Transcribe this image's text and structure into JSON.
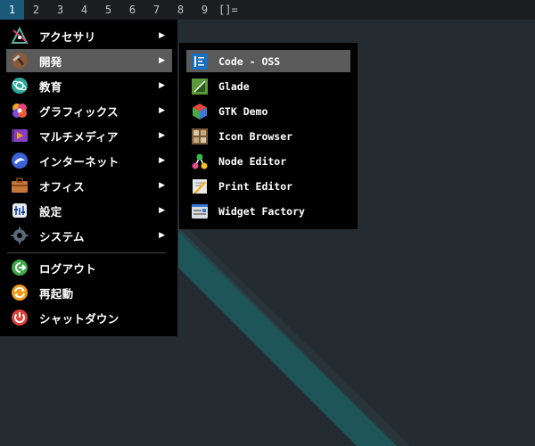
{
  "topbar": {
    "workspaces": [
      "1",
      "2",
      "3",
      "4",
      "5",
      "6",
      "7",
      "8",
      "9"
    ],
    "active_workspace": "1",
    "layout_symbol": "[]="
  },
  "menu": {
    "categories": [
      {
        "label": "アクセサリ",
        "icon": "accessories-icon",
        "has_submenu": true
      },
      {
        "label": "開発",
        "icon": "development-icon",
        "has_submenu": true
      },
      {
        "label": "教育",
        "icon": "education-icon",
        "has_submenu": true
      },
      {
        "label": "グラフィックス",
        "icon": "graphics-icon",
        "has_submenu": true
      },
      {
        "label": "マルチメディア",
        "icon": "multimedia-icon",
        "has_submenu": true
      },
      {
        "label": "インターネット",
        "icon": "internet-icon",
        "has_submenu": true
      },
      {
        "label": "オフィス",
        "icon": "office-icon",
        "has_submenu": true
      },
      {
        "label": "設定",
        "icon": "settings-icon",
        "has_submenu": true
      },
      {
        "label": "システム",
        "icon": "system-icon",
        "has_submenu": true
      }
    ],
    "session": [
      {
        "label": "ログアウト",
        "icon": "logout-icon"
      },
      {
        "label": "再起動",
        "icon": "restart-icon"
      },
      {
        "label": "シャットダウン",
        "icon": "shutdown-icon"
      }
    ],
    "arrow_glyph": "▶",
    "highlighted_category": "開発"
  },
  "submenu": {
    "items": [
      {
        "label": "Code - OSS",
        "icon": "code-oss-icon"
      },
      {
        "label": "Glade",
        "icon": "glade-icon"
      },
      {
        "label": "GTK Demo",
        "icon": "gtk-demo-icon"
      },
      {
        "label": "Icon Browser",
        "icon": "icon-browser-icon"
      },
      {
        "label": "Node Editor",
        "icon": "node-editor-icon"
      },
      {
        "label": "Print Editor",
        "icon": "print-editor-icon"
      },
      {
        "label": "Widget Factory",
        "icon": "widget-factory-icon"
      }
    ],
    "highlighted_item": "Code - OSS"
  },
  "colors": {
    "topbar_bg": "#1b1e20",
    "active_workspace_bg": "#1a5b7c",
    "menu_bg": "#000000",
    "highlight_bg": "#5a5a5a",
    "wallpaper_dark": "#252c31",
    "wallpaper_teal": "#1d5558"
  }
}
